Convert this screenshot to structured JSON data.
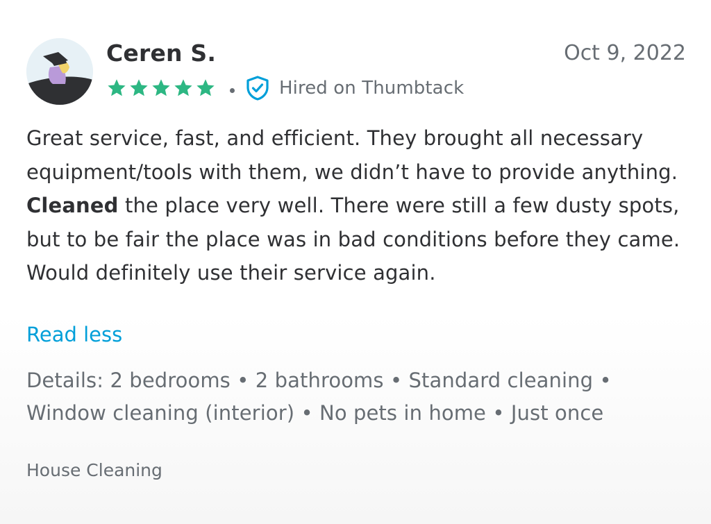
{
  "review": {
    "author": "Ceren S.",
    "date": "Oct 9, 2022",
    "rating": 5,
    "max_rating": 5,
    "hired_label": "Hired on Thumbtack",
    "body": {
      "before_bold": "Great service, fast, and efficient. They brought all necessary equipment/tools with them, we didn’t have to provide anything. ",
      "bold": "Cleaned",
      "after_bold": " the place very well. There were still a few dusty spots, but to be fair the place was in bad conditions before they came. Would definitely use their service again."
    },
    "read_less_label": "Read less",
    "details_prefix": "Details:",
    "details": [
      "2 bedrooms",
      "2 bathrooms",
      "Standard cleaning",
      "Window cleaning (interior)",
      "No pets in home",
      "Just once"
    ],
    "category": "House Cleaning"
  },
  "icons": {
    "avatar": "avatar-illustration",
    "star": "star-icon",
    "shield": "shield-check-icon"
  },
  "colors": {
    "star": "#2db783",
    "link": "#009fd9",
    "shield": "#009fd9",
    "text": "#2f3033",
    "muted": "#676d73"
  }
}
